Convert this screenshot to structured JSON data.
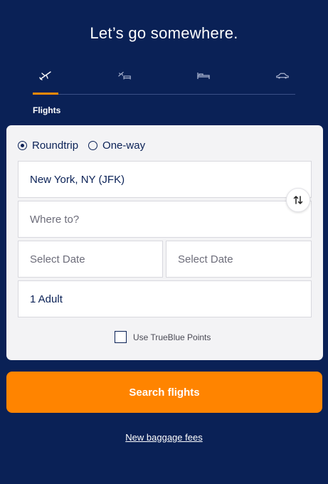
{
  "header": {
    "title": "Let’s go somewhere."
  },
  "tabs": [
    {
      "icon": "plane-icon",
      "active": true
    },
    {
      "icon": "flight-hotel-icon",
      "active": false
    },
    {
      "icon": "bed-icon",
      "active": false
    },
    {
      "icon": "car-icon",
      "active": false
    }
  ],
  "active_tab_label": "Flights",
  "form": {
    "trip_types": [
      {
        "label": "Roundtrip",
        "selected": true
      },
      {
        "label": "One-way",
        "selected": false
      }
    ],
    "origin": {
      "value": "New York, NY (JFK)"
    },
    "destination": {
      "placeholder": "Where to?"
    },
    "depart_date": {
      "placeholder": "Select Date"
    },
    "return_date": {
      "placeholder": "Select Date"
    },
    "travelers": {
      "value": "1 Adult"
    },
    "swap_icon": "swap-arrows-icon",
    "points_label": "Use TrueBlue Points",
    "points_checked": false
  },
  "search_button": {
    "label": "Search flights"
  },
  "footer_link": {
    "label": "New baggage fees"
  },
  "colors": {
    "background": "#0a2156",
    "accent": "#ff8400",
    "card": "#f3f3f5"
  }
}
